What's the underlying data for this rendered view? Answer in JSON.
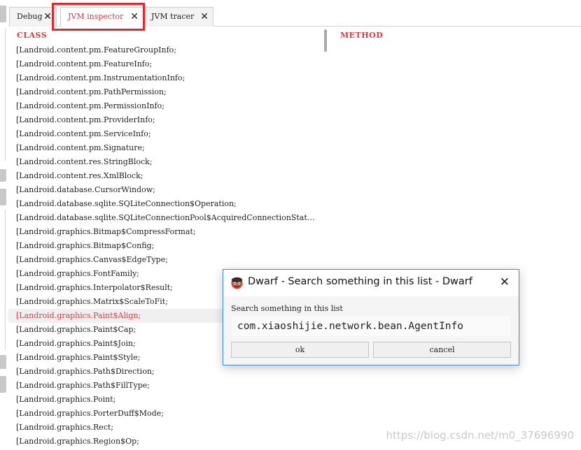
{
  "tabs": [
    {
      "label": "Debug"
    },
    {
      "label": "JVM inspector"
    },
    {
      "label": "JVM tracer"
    }
  ],
  "columns": {
    "class": "CLASS",
    "method": "METHOD"
  },
  "class_list": [
    "[Landroid.content.pm.FeatureGroupInfo;",
    "[Landroid.content.pm.FeatureInfo;",
    "[Landroid.content.pm.InstrumentationInfo;",
    "[Landroid.content.pm.PathPermission;",
    "[Landroid.content.pm.PermissionInfo;",
    "[Landroid.content.pm.ProviderInfo;",
    "[Landroid.content.pm.ServiceInfo;",
    "[Landroid.content.pm.Signature;",
    "[Landroid.content.res.StringBlock;",
    "[Landroid.content.res.XmlBlock;",
    "[Landroid.database.CursorWindow;",
    "[Landroid.database.sqlite.SQLiteConnection$Operation;",
    "[Landroid.database.sqlite.SQLiteConnectionPool$AcquiredConnectionStat…",
    "[Landroid.graphics.Bitmap$CompressFormat;",
    "[Landroid.graphics.Bitmap$Config;",
    "[Landroid.graphics.Canvas$EdgeType;",
    "[Landroid.graphics.FontFamily;",
    "[Landroid.graphics.Interpolator$Result;",
    "[Landroid.graphics.Matrix$ScaleToFit;",
    "[Landroid.graphics.Paint$Align;",
    "[Landroid.graphics.Paint$Cap;",
    "[Landroid.graphics.Paint$Join;",
    "[Landroid.graphics.Paint$Style;",
    "[Landroid.graphics.Path$Direction;",
    "[Landroid.graphics.Path$FillType;",
    "[Landroid.graphics.Point;",
    "[Landroid.graphics.PorterDuff$Mode;",
    "[Landroid.graphics.Rect;",
    "[Landroid.graphics.Region$Op;"
  ],
  "selected_row": 19,
  "dialog": {
    "title": "Dwarf - Search something in this list - Dwarf",
    "label": "Search something in this list",
    "input_value": "com.xiaoshijie.network.bean.AgentInfo",
    "ok_label": "ok",
    "cancel_label": "cancel",
    "logo_icon": "dwarf-logo-icon",
    "close_icon": "close-icon"
  },
  "watermark": "https://blog.csdn.net/m0_37696990",
  "colors": {
    "accent": "#e03a3a",
    "highlight_box": "#e8262b",
    "dialog_border": "#3c8fd6"
  }
}
